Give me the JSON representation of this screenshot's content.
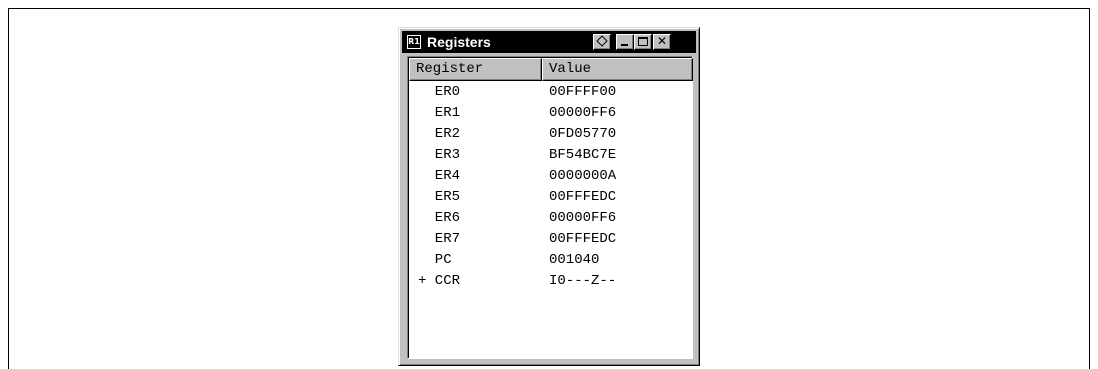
{
  "window": {
    "title": "Registers",
    "icon_label": "R1",
    "icon_name": "registers-app-icon",
    "controls": [
      "pin-icon",
      "minimize-icon",
      "maximize-icon",
      "close-icon"
    ]
  },
  "table": {
    "columns": [
      "Register",
      "Value"
    ],
    "rows": [
      {
        "name": "  ER0",
        "value": "00FFFF00"
      },
      {
        "name": "  ER1",
        "value": "00000FF6"
      },
      {
        "name": "  ER2",
        "value": "0FD05770"
      },
      {
        "name": "  ER3",
        "value": "BF54BC7E"
      },
      {
        "name": "  ER4",
        "value": "0000000A"
      },
      {
        "name": "  ER5",
        "value": "00FFFEDC"
      },
      {
        "name": "  ER6",
        "value": "00000FF6"
      },
      {
        "name": "  ER7",
        "value": "00FFFEDC"
      },
      {
        "name": "  PC",
        "value": "001040"
      },
      {
        "name": "+ CCR",
        "value": "I0---Z--"
      }
    ]
  }
}
